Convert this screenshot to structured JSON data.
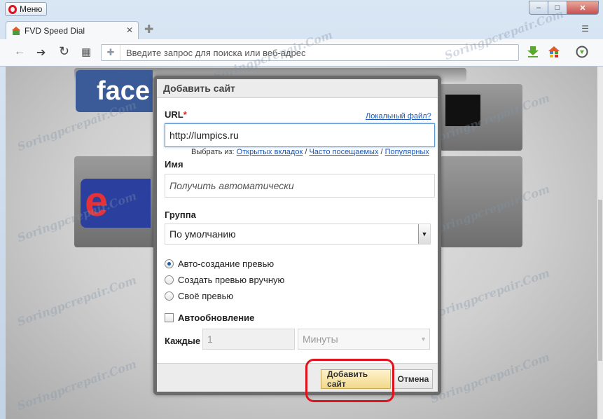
{
  "window": {
    "menu_label": "Меню",
    "minimize_glyph": "–",
    "maximize_glyph": "□",
    "close_glyph": "✕"
  },
  "tabs": [
    {
      "title": "FVD Speed Dial",
      "close_glyph": "✕"
    }
  ],
  "tabbar": {
    "new_tab_glyph": "✚",
    "menu_glyph": "☰"
  },
  "toolbar": {
    "back_glyph": "←",
    "forward_glyph": "➔",
    "reload_glyph": "↻",
    "speed_dial_glyph": "▦",
    "address_placeholder": "Введите запрос для поиска или веб-адрес",
    "accent_colors": {
      "download": "#5aa832",
      "opera_red": "#e0121e"
    }
  },
  "speed_dial": {
    "tile_facebook_text": "face",
    "tile_ebay_text": "e"
  },
  "dialog": {
    "title": "Добавить сайт",
    "url": {
      "label": "URL",
      "required_mark": "*",
      "local_file_link": "Локальный файл?",
      "value": "http://lumpics.ru",
      "choose_from_label": "Выбрать из:",
      "choose_links": [
        "Открытых вкладок",
        "Часто посещаемых",
        "Популярных"
      ],
      "separator": "/"
    },
    "name": {
      "label": "Имя",
      "placeholder": "Получить автоматически"
    },
    "group": {
      "label": "Группа",
      "selected": "По умолчанию"
    },
    "preview_options": [
      {
        "label": "Авто-создание превью",
        "checked": true
      },
      {
        "label": "Создать превью вручную",
        "checked": false
      },
      {
        "label": "Своё превью",
        "checked": false
      }
    ],
    "auto_update": {
      "label": "Автообновление",
      "checked": false
    },
    "every": {
      "label": "Каждые",
      "value": "1",
      "unit": "Минуты"
    },
    "buttons": {
      "add": "Добавить сайт",
      "cancel": "Отмена"
    }
  },
  "watermark": "Soringpcrepair.Com"
}
